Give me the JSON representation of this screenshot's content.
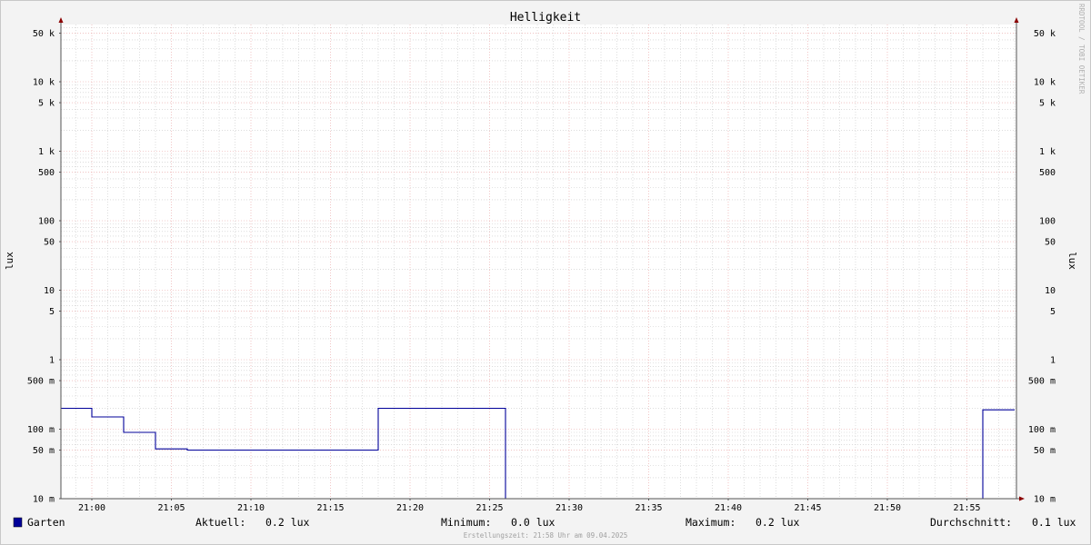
{
  "chart_data": {
    "type": "line",
    "title": "Helligkeit",
    "ylabel_left": "lux",
    "ylabel_right": "lux",
    "y_scale": "log",
    "ylim": [
      0.01,
      80000
    ],
    "x_tick_labels": [
      "21:00",
      "21:05",
      "21:10",
      "21:15",
      "21:20",
      "21:25",
      "21:30",
      "21:35",
      "21:40",
      "21:45",
      "21:50",
      "21:55"
    ],
    "y_ticks": [
      {
        "value": 0.01,
        "label": "10 m"
      },
      {
        "value": 0.05,
        "label": "50 m"
      },
      {
        "value": 0.1,
        "label": "100 m"
      },
      {
        "value": 0.5,
        "label": "500 m"
      },
      {
        "value": 1,
        "label": "1"
      },
      {
        "value": 5,
        "label": "5"
      },
      {
        "value": 10,
        "label": "10"
      },
      {
        "value": 50,
        "label": "50"
      },
      {
        "value": 100,
        "label": "100"
      },
      {
        "value": 500,
        "label": "500"
      },
      {
        "value": 1000,
        "label": "1 k"
      },
      {
        "value": 5000,
        "label": "5 k"
      },
      {
        "value": 10000,
        "label": "10 k"
      },
      {
        "value": 50000,
        "label": "50 k"
      }
    ],
    "series": [
      {
        "name": "Garten",
        "color": "#000099",
        "x": [
          "20:58",
          "21:00",
          "21:00",
          "21:02",
          "21:02",
          "21:04",
          "21:04",
          "21:06",
          "21:06",
          "21:18",
          "21:18",
          "21:26",
          "21:26",
          "21:56",
          "21:56",
          "21:58"
        ],
        "y": [
          0.2,
          0.2,
          0.15,
          0.15,
          0.09,
          0.09,
          0.052,
          0.052,
          0.05,
          0.05,
          0.2,
          0.2,
          0.01,
          0.01,
          0.19,
          0.19
        ]
      }
    ],
    "grid": true,
    "grid_major_color": "#e8a0a0",
    "grid_minor_color": "#c8c8c8",
    "axis_arrow_color": "#8b0000"
  },
  "legend": {
    "series_label": "Garten",
    "swatch_color": "#000099",
    "current_label": "Aktuell:",
    "current_value": "0.2 lux",
    "min_label": "Minimum:",
    "min_value": "0.0 lux",
    "max_label": "Maximum:",
    "max_value": "0.2 lux",
    "avg_label": "Durchschnitt:",
    "avg_value": "0.1 lux"
  },
  "footer": "Erstellungszeit: 21:58 Uhr am 09.04.2025",
  "watermark": "RRDTOOL / TOBI OETIKER"
}
